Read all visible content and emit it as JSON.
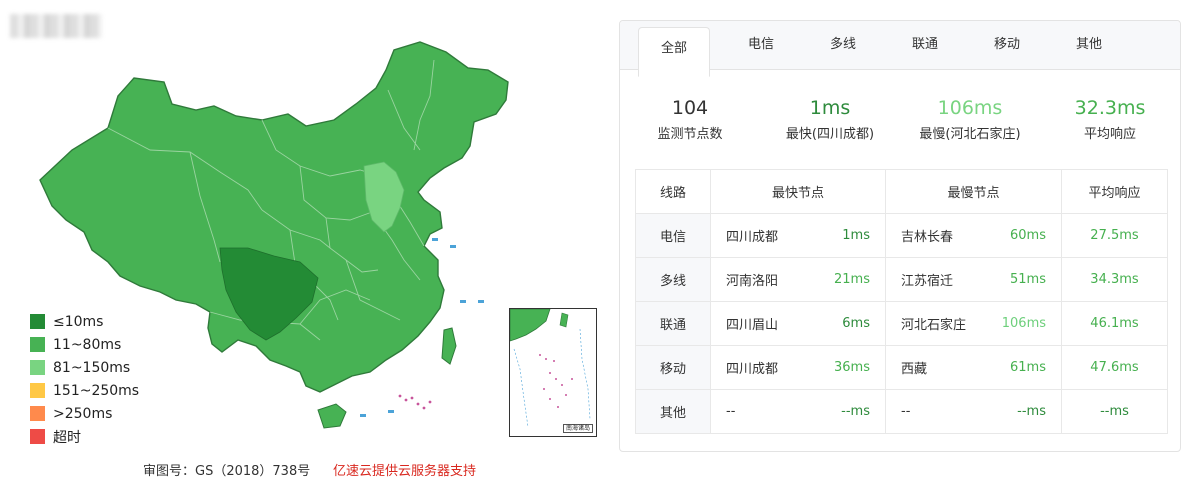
{
  "legend": [
    {
      "label": "≤10ms",
      "color": "#238b35"
    },
    {
      "label": "11~80ms",
      "color": "#47b254"
    },
    {
      "label": "81~150ms",
      "color": "#79d481"
    },
    {
      "label": "151~250ms",
      "color": "#ffc845"
    },
    {
      "label": ">250ms",
      "color": "#ff8a4c"
    },
    {
      "label": "超时",
      "color": "#ee4b46"
    }
  ],
  "map": {
    "inset_label": "南海诸岛",
    "base_color": "#47b254",
    "highlight_fast": "#238b35",
    "highlight_slow": "#79d481"
  },
  "footer": {
    "approval": "审图号：GS（2018）738号",
    "support": "亿速云提供云服务器支持"
  },
  "tabs": [
    "全部",
    "电信",
    "多线",
    "联通",
    "移动",
    "其他"
  ],
  "stats": [
    {
      "value": "104",
      "label": "监测节点数",
      "color": "#333333"
    },
    {
      "value": "1ms",
      "label": "最快(四川成都)",
      "color": "#2e8b3c"
    },
    {
      "value": "106ms",
      "label": "最慢(河北石家庄)",
      "color": "#79d481"
    },
    {
      "value": "32.3ms",
      "label": "平均响应",
      "color": "#46b04f"
    }
  ],
  "table": {
    "headers": [
      "线路",
      "最快节点",
      "最慢节点",
      "平均响应"
    ],
    "rows": [
      {
        "line": "电信",
        "fast_node": "四川成都",
        "fast_ms": "1ms",
        "slow_node": "吉林长春",
        "slow_ms": "60ms",
        "avg": "27.5ms"
      },
      {
        "line": "多线",
        "fast_node": "河南洛阳",
        "fast_ms": "21ms",
        "slow_node": "江苏宿迁",
        "slow_ms": "51ms",
        "avg": "34.3ms"
      },
      {
        "line": "联通",
        "fast_node": "四川眉山",
        "fast_ms": "6ms",
        "slow_node": "河北石家庄",
        "slow_ms": "106ms",
        "avg": "46.1ms"
      },
      {
        "line": "移动",
        "fast_node": "四川成都",
        "fast_ms": "36ms",
        "slow_node": "西藏",
        "slow_ms": "61ms",
        "avg": "47.6ms"
      },
      {
        "line": "其他",
        "fast_node": "--",
        "fast_ms": "--ms",
        "slow_node": "--",
        "slow_ms": "--ms",
        "avg": "--ms"
      }
    ]
  }
}
